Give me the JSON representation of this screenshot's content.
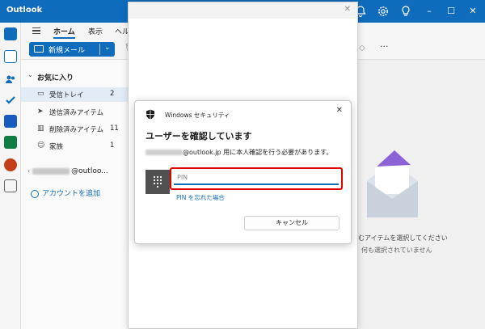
{
  "app": {
    "title": "Outlook"
  },
  "ribbon": {
    "tabs": [
      "ホーム",
      "表示",
      "ヘル"
    ],
    "new_mail": "新規メール"
  },
  "folders": {
    "favorites_label": "お気に入り",
    "items": [
      {
        "label": "受信トレイ",
        "count": "2",
        "icon": "inbox-icon"
      },
      {
        "label": "送信済みアイテム",
        "count": "",
        "icon": "send-icon"
      },
      {
        "label": "削除済みアイテム",
        "count": "11",
        "icon": "trash-icon"
      },
      {
        "label": "家族",
        "count": "1",
        "icon": "people-icon"
      }
    ],
    "account_suffix": "@outloo...",
    "add_account": "アカウントを追加"
  },
  "reading_pane": {
    "line1": "むアイテムを選択してください",
    "line2": "何も選択されていません"
  },
  "security_dialog": {
    "window_title": "Windows セキュリティ",
    "heading": "ユーザーを確認しています",
    "description_suffix": "@outlook.jp 用に本人確認を行う必要があります。",
    "pin_placeholder": "PIN",
    "forgot_pin": "PIN を忘れた場合",
    "cancel": "キャンセル"
  },
  "colors": {
    "brand": "#0f6cbd",
    "highlight": "#e00000"
  }
}
